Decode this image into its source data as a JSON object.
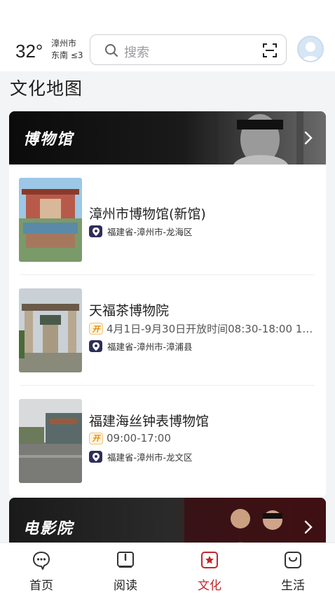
{
  "header": {
    "temperature": "32°",
    "city": "漳州市",
    "wind": "东南 ≤3",
    "search_placeholder": "搜索"
  },
  "page_title": "文化地图",
  "sections": [
    {
      "title": "博物馆",
      "items": [
        {
          "name": "漳州市博物馆(新馆)",
          "address": "福建省-漳州市-龙海区"
        },
        {
          "name": "天福茶博物院",
          "open_badge": "开",
          "hours": "4月1日-9月30日开放时间08:30-18:00 1…",
          "address": "福建省-漳州市-漳浦县"
        },
        {
          "name": "福建海丝钟表博物馆",
          "open_badge": "开",
          "hours": "09:00-17:00",
          "address": "福建省-漳州市-龙文区"
        }
      ]
    },
    {
      "title": "电影院"
    }
  ],
  "tabbar": {
    "items": [
      {
        "label": "首页",
        "icon": "home-bubble-icon"
      },
      {
        "label": "阅读",
        "icon": "book-icon"
      },
      {
        "label": "文化",
        "icon": "culture-star-icon",
        "active": true
      },
      {
        "label": "生活",
        "icon": "life-smile-icon"
      }
    ],
    "active_color": "#c1272d"
  }
}
